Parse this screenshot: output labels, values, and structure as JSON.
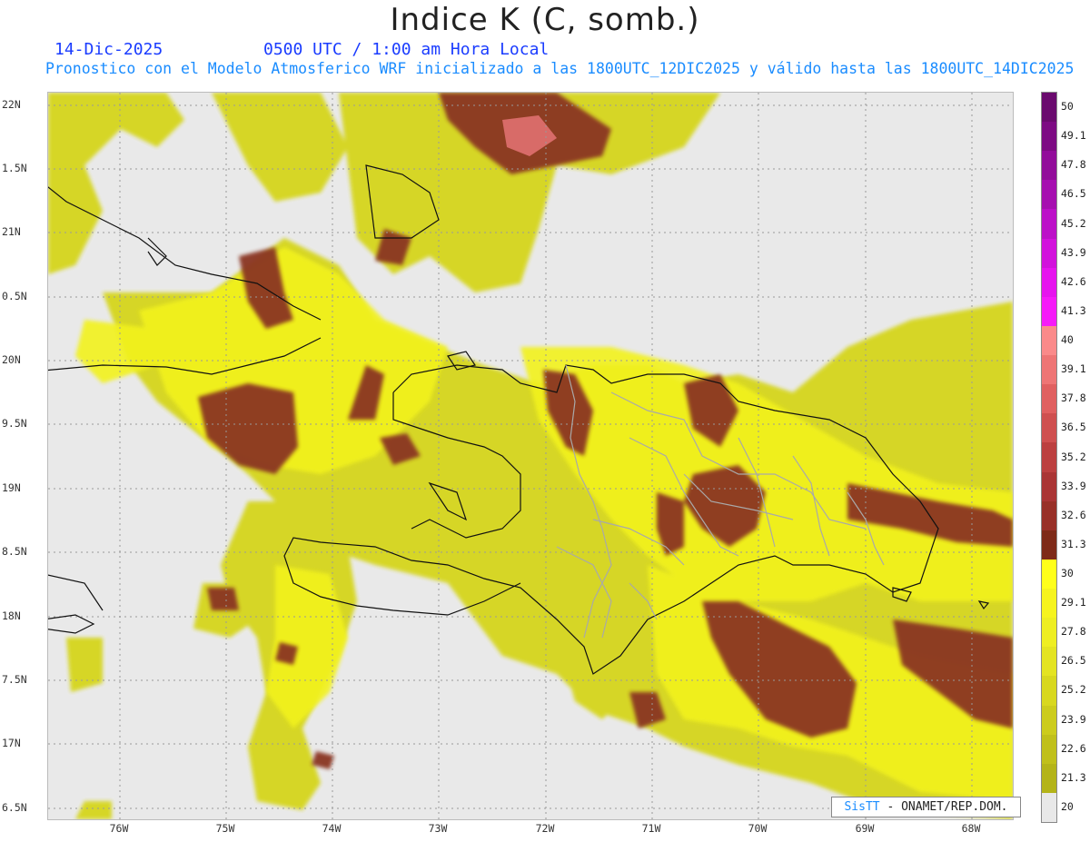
{
  "header": {
    "title": "Indice K (C, somb.)",
    "date": "14-Dic-2025",
    "valid_time": "0500 UTC / 1:00 am Hora Local",
    "subtitle": "Pronostico con el Modelo Atmosferico WRF inicializado a las 1800UTC_12DIC2025 y válido hasta las  1800UTC_14DIC2025"
  },
  "axes": {
    "lat_labels": [
      "22N",
      "1.5N",
      "21N",
      "0.5N",
      "20N",
      "9.5N",
      "19N",
      "8.5N",
      "18N",
      "7.5N",
      "17N",
      "6.5N"
    ],
    "lon_labels": [
      "76W",
      "75W",
      "74W",
      "73W",
      "72W",
      "71W",
      "70W",
      "69W",
      "68W"
    ]
  },
  "colorbar": {
    "labels": [
      "50",
      "49.1",
      "47.8",
      "46.5",
      "45.2",
      "43.9",
      "42.6",
      "41.3",
      "40",
      "39.1",
      "37.8",
      "36.5",
      "35.2",
      "33.9",
      "32.6",
      "31.3",
      "30",
      "29.1",
      "27.8",
      "26.5",
      "25.2",
      "23.9",
      "22.6",
      "21.3",
      "20"
    ],
    "colors": [
      "#6a0a6e",
      "#7d0a83",
      "#920c9a",
      "#a60fb0",
      "#bc10c8",
      "#d212dc",
      "#e614ee",
      "#f51af8",
      "#fa8a8a",
      "#ee7575",
      "#e06060",
      "#cf5050",
      "#bc4040",
      "#aa3535",
      "#983028",
      "#7e2a18",
      "#ffff1a",
      "#f6f41e",
      "#eeee22",
      "#e4e422",
      "#d8d81f",
      "#cccc1d",
      "#c0c01b",
      "#b4b419",
      "#e8e8e8"
    ]
  },
  "credit": {
    "sis": "SisTT",
    "rest": " - ONAMET/REP.DOM."
  }
}
